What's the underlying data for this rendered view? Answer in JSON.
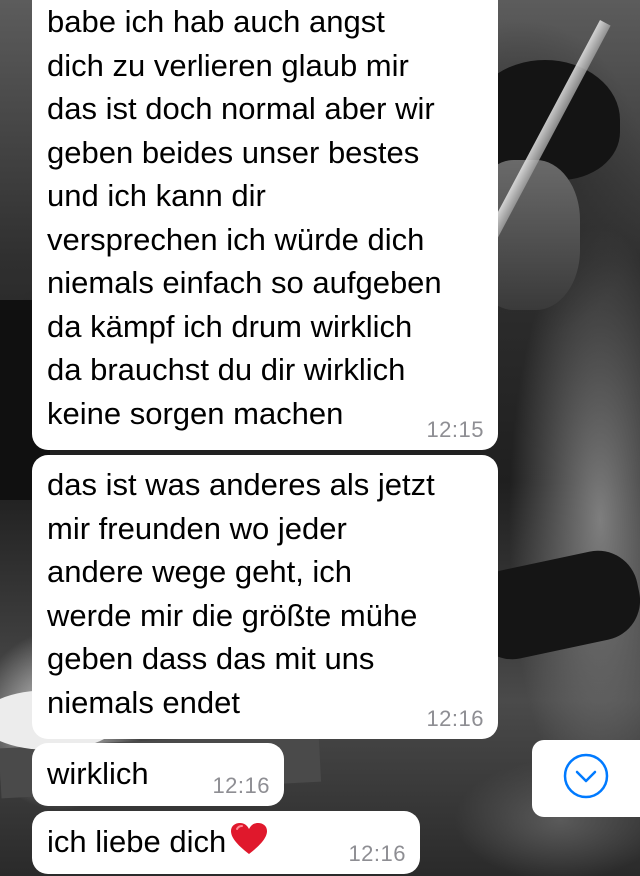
{
  "chat": {
    "messages": [
      {
        "text": "babe ich hab auch angst\ndich zu verlieren glaub mir\ndas ist doch normal aber wir\ngeben beides unser bestes\nund ich kann dir\nversprechen ich würde dich\nniemals einfach so aufgeben\nda kämpf ich drum wirklich\nda brauchst du dir wirklich\nkeine sorgen machen",
        "time": "12:15"
      },
      {
        "text": "das ist was anderes als jetzt\nmir freunden wo jeder\nandere wege geht, ich\nwerde mir die größte mühe\ngeben dass das mit uns\nniemals endet",
        "time": "12:16"
      },
      {
        "text": "wirklich",
        "time": "12:16"
      },
      {
        "text": "ich liebe dich",
        "emoji": "heart-emoji",
        "time": "12:16"
      }
    ]
  },
  "scroll_to_bottom": {
    "icon": "chevron-down-circle-icon",
    "color": "#007aff"
  },
  "colors": {
    "bubble": "#ffffff",
    "timestamp": "#8e8e93",
    "heart": "#e0182c"
  }
}
